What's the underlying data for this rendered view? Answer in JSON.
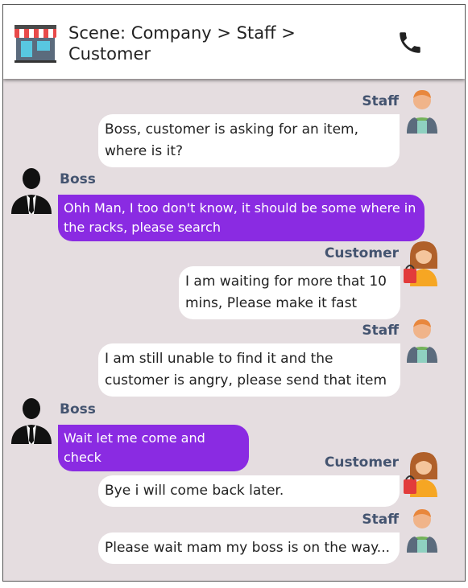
{
  "header": {
    "title_line1": "Scene: Company > Staff >",
    "title_line2": "Customer",
    "store_icon": "store-icon",
    "phone_icon": "phone-icon"
  },
  "messages": [
    {
      "sender": "Staff",
      "text": "Boss, customer is asking for an item, where is it?",
      "avatar": "staff-avatar"
    },
    {
      "sender": "Boss",
      "text": "Ohh Man, I too don't know, it should be some where in the racks, please search",
      "avatar": "boss-avatar"
    },
    {
      "sender": "Customer",
      "text": "I am waiting for more that 10 mins, Please make it fast",
      "avatar": "customer-avatar"
    },
    {
      "sender": "Staff",
      "text": "I am still unable to find it and the customer is angry, please send that item",
      "avatar": "staff-avatar"
    },
    {
      "sender": "Boss",
      "text": "Wait let me come and check",
      "avatar": "boss-avatar"
    },
    {
      "sender": "Customer",
      "text": "Bye i will come back later.",
      "avatar": "customer-avatar"
    },
    {
      "sender": "Staff",
      "text": "Please wait mam my boss is on the way...",
      "avatar": "staff-avatar"
    }
  ],
  "colors": {
    "boss_bubble": "#8a2be2",
    "other_bubble": "#ffffff",
    "chat_bg": "#e5dde0",
    "name_color": "#445470"
  }
}
